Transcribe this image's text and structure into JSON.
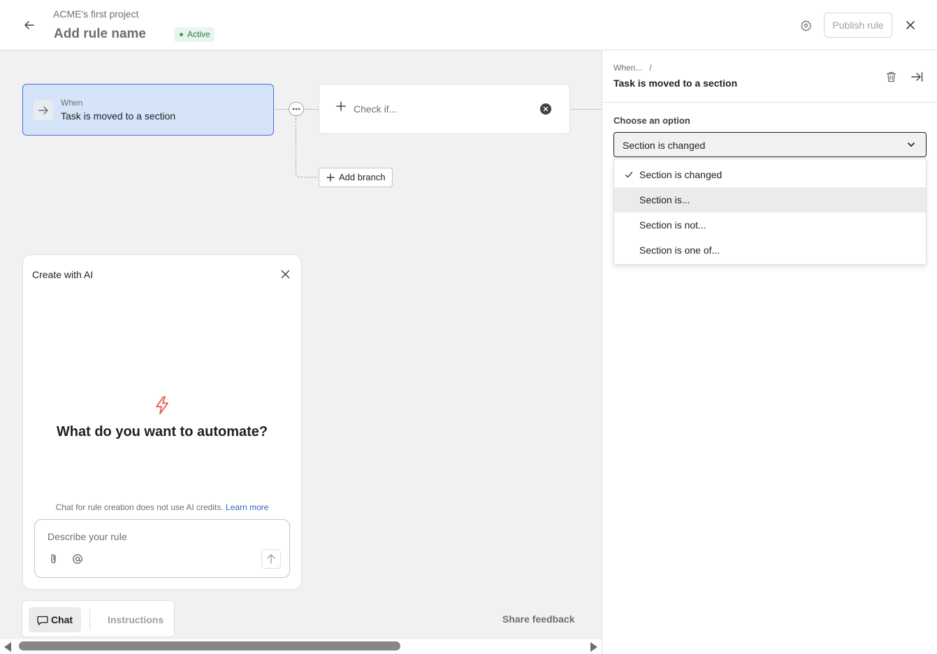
{
  "header": {
    "project_name": "ACME's first project",
    "rule_name": "Add rule name",
    "status": "Active",
    "publish_label": "Publish rule"
  },
  "canvas": {
    "trigger": {
      "when_label": "When",
      "text": "Task is moved to a section"
    },
    "check_label": "Check if...",
    "add_branch_label": "Add branch"
  },
  "ai_panel": {
    "title": "Create with AI",
    "heading": "What do you want to automate?",
    "note": "Chat for rule creation does not use AI credits.",
    "learn_more": "Learn more",
    "input_placeholder": "Describe your rule"
  },
  "tabs": {
    "chat": "Chat",
    "instructions": "Instructions"
  },
  "share_feedback": "Share feedback",
  "side_panel": {
    "breadcrumb": "When...",
    "breadcrumb_sep": "/",
    "title": "Task is moved to a section",
    "option_label": "Choose an option",
    "selected_value": "Section is changed",
    "options": [
      {
        "label": "Section is changed",
        "selected": true
      },
      {
        "label": "Section is...",
        "selected": false
      },
      {
        "label": "Section is not...",
        "selected": false
      },
      {
        "label": "Section is one of...",
        "selected": false
      }
    ]
  },
  "colors": {
    "accent_blue": "#4573d2",
    "trigger_bg": "#d6e4fa",
    "active_green": "#2d7a48",
    "link": "#2e6aba",
    "ai_bolt": "#e8584f"
  }
}
